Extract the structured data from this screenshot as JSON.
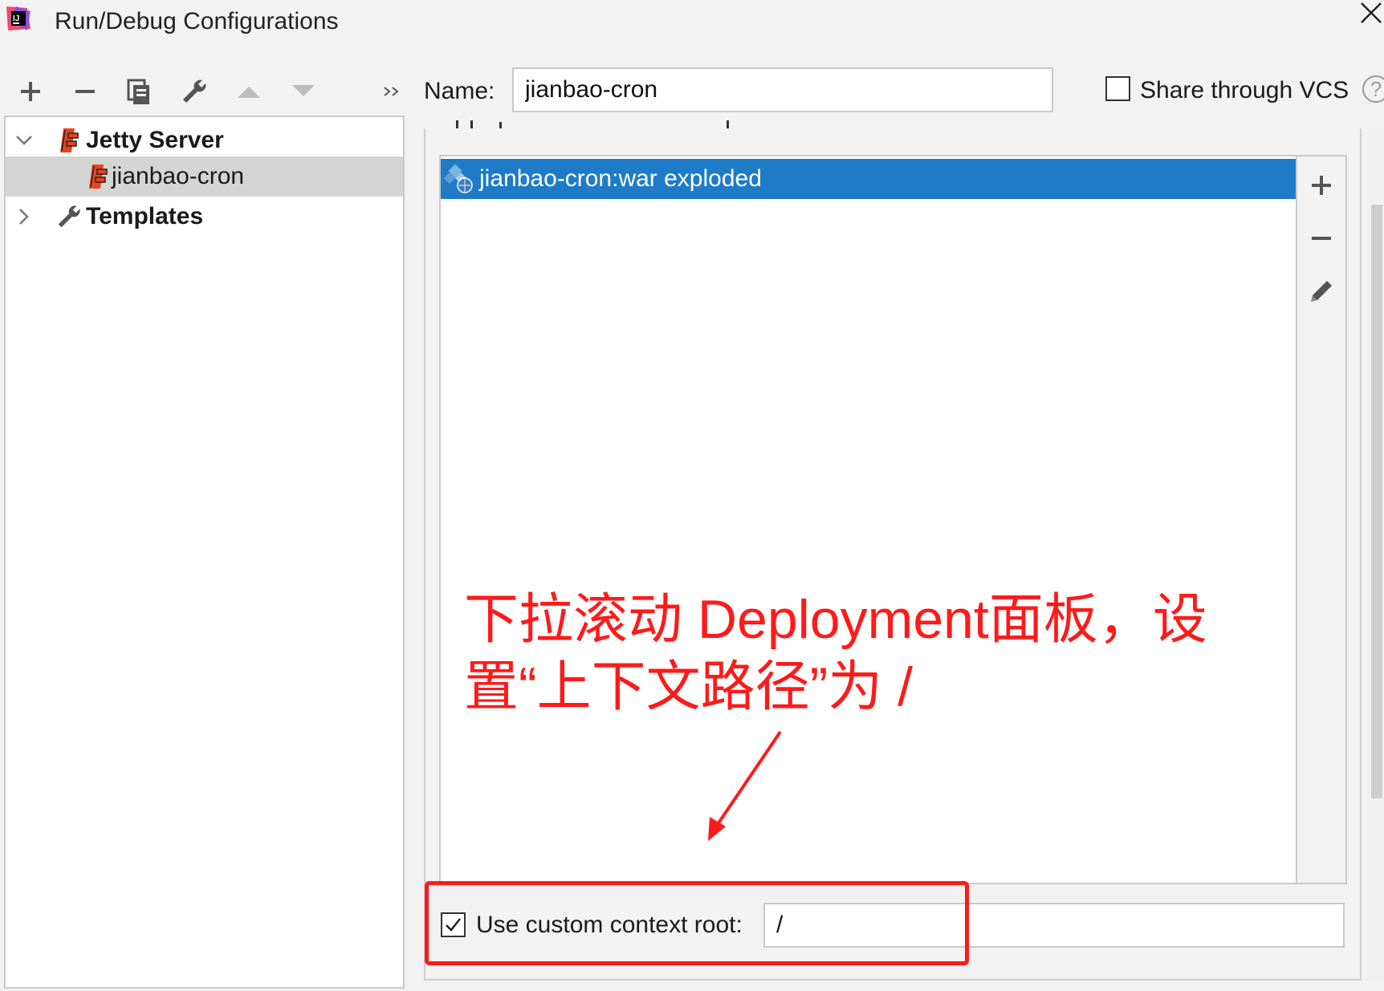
{
  "window": {
    "title": "Run/Debug Configurations",
    "app_icon": "intellij-idea-icon",
    "close_icon": "close-icon"
  },
  "toolbar": {
    "buttons": [
      "add-icon",
      "remove-icon",
      "copy-icon",
      "wrench-icon",
      "move-up-icon",
      "move-down-icon",
      "more-icon"
    ]
  },
  "name_field": {
    "label": "Name:",
    "value": "jianbao-cron"
  },
  "vcs": {
    "label": "Share through VCS",
    "checked": false,
    "help_icon": "?"
  },
  "tree": {
    "items": [
      {
        "label": "Jetty Server",
        "bold": true,
        "expanded": true,
        "icon": "jetty-icon"
      },
      {
        "label": "jianbao-cron",
        "bold": false,
        "selected": true,
        "icon": "jetty-icon"
      },
      {
        "label": "Templates",
        "bold": true,
        "expanded": false,
        "icon": "wrench-icon"
      }
    ]
  },
  "deployment": {
    "artifacts": [
      {
        "label": "jianbao-cron:war exploded",
        "selected": true,
        "icon": "war-artifact-icon"
      }
    ],
    "side_actions": [
      "add-icon",
      "remove-icon",
      "edit-icon"
    ]
  },
  "context_root": {
    "label": "Use custom context root:",
    "checked": true,
    "value": "/"
  },
  "annotation": {
    "text": "下拉滚动 Deployment面板，设置“上下文路径”为 /",
    "color": "#ff1a1a"
  },
  "colors": {
    "selection_blue": "#1e7bc8",
    "tree_selection": "#d4d4d4",
    "background": "#f2f2f2",
    "annotation_red": "#ff1a1a"
  }
}
